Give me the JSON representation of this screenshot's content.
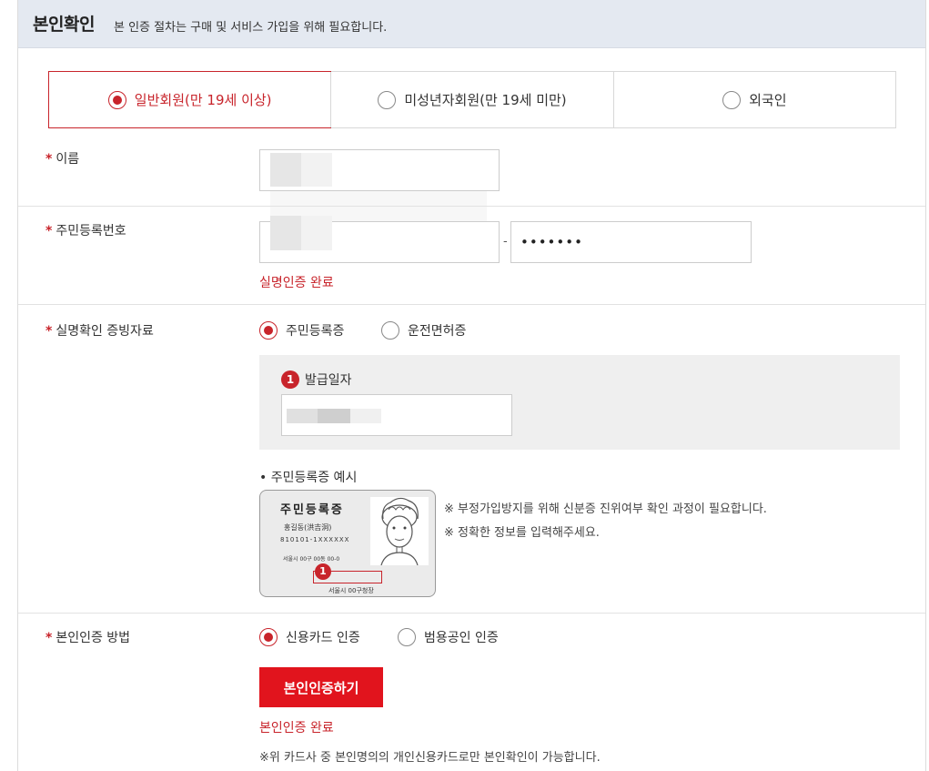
{
  "header": {
    "title": "본인확인",
    "description": "본 인증 절차는 구매 및 서비스 가입을 위해 필요합니다."
  },
  "member_tabs": [
    {
      "label": "일반회원(만 19세 이상)",
      "selected": true
    },
    {
      "label": "미성년자회원(만 19세 미만)",
      "selected": false
    },
    {
      "label": "외국인",
      "selected": false
    }
  ],
  "form": {
    "required_mark": "*",
    "name": {
      "label": "이름",
      "value": ""
    },
    "rrn": {
      "label": "주민등록번호",
      "front_value": "",
      "separator": "-",
      "back_value": "•••••••",
      "status": "실명인증 완료"
    },
    "proof": {
      "label": "실명확인 증빙자료",
      "options": [
        {
          "label": "주민등록증",
          "selected": true
        },
        {
          "label": "운전면허증",
          "selected": false
        }
      ],
      "issue_date": {
        "badge": "1",
        "label": "발급일자",
        "value": ""
      },
      "example_title": "• 주민등록증 예시",
      "example_card": {
        "title": "주민등록증",
        "name": "홍길동(洪吉洞)",
        "number": "810101-1XXXXXX",
        "address": "서울시 00구 00동 00-0",
        "issuer": "서울시 00구청장",
        "badge": "1"
      },
      "notes": [
        "※ 부정가입방지를 위해 신분증 진위여부 확인 과정이 필요합니다.",
        "※ 정확한 정보를 입력해주세요."
      ]
    },
    "auth_method": {
      "label": "본인인증 방법",
      "options": [
        {
          "label": "신용카드 인증",
          "selected": true
        },
        {
          "label": "범용공인 인증",
          "selected": false
        }
      ],
      "button_label": "본인인증하기",
      "status": "본인인증 완료",
      "note": "※위 카드사 중 본인명의의 개인신용카드로만 본인확인이 가능합니다."
    }
  },
  "colors": {
    "accent": "#c8242b",
    "button": "#e1141d",
    "header_bg": "#e4e9f1"
  }
}
